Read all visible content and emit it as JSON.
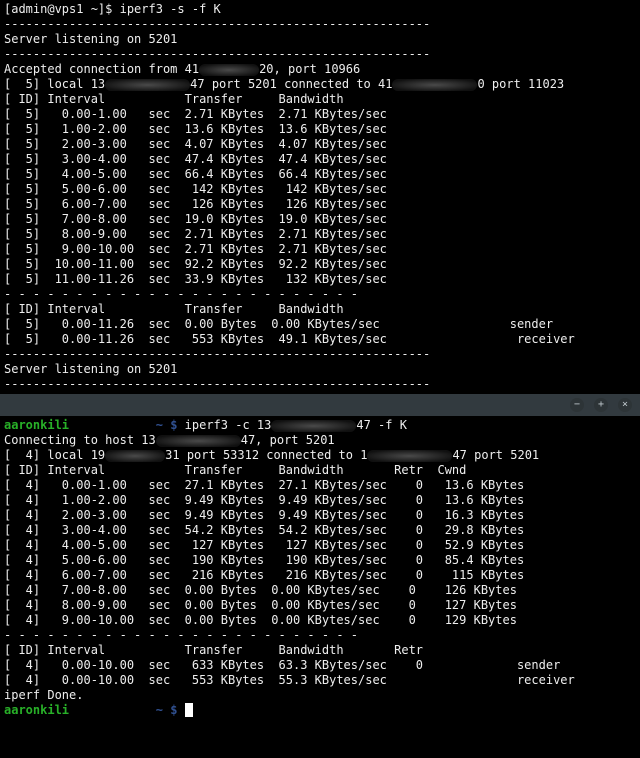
{
  "top": {
    "prompt": "[admin@vps1 ~]$ iperf3 -s -f K",
    "listening": "Server listening on 5201",
    "divider": "-----------------------------------------------------------",
    "accepted_pre": "Accepted connection from 41",
    "accepted_post": "20, port 10966",
    "local_pre": "[  5] local 13",
    "local_mid": "47 port 5201 connected to 41",
    "local_post": "0 port 11023",
    "header": "[ ID] Interval           Transfer     Bandwidth",
    "rows": [
      "[  5]   0.00-1.00   sec  2.71 KBytes  2.71 KBytes/sec                  ",
      "[  5]   1.00-2.00   sec  13.6 KBytes  13.6 KBytes/sec                  ",
      "[  5]   2.00-3.00   sec  4.07 KBytes  4.07 KBytes/sec                  ",
      "[  5]   3.00-4.00   sec  47.4 KBytes  47.4 KBytes/sec                  ",
      "[  5]   4.00-5.00   sec  66.4 KBytes  66.4 KBytes/sec                  ",
      "[  5]   5.00-6.00   sec   142 KBytes   142 KBytes/sec                  ",
      "[  5]   6.00-7.00   sec   126 KBytes   126 KBytes/sec                  ",
      "[  5]   7.00-8.00   sec  19.0 KBytes  19.0 KBytes/sec                  ",
      "[  5]   8.00-9.00   sec  2.71 KBytes  2.71 KBytes/sec                  ",
      "[  5]   9.00-10.00  sec  2.71 KBytes  2.71 KBytes/sec                  ",
      "[  5]  10.00-11.00  sec  92.2 KBytes  92.2 KBytes/sec                  ",
      "[  5]  11.00-11.26  sec  33.9 KBytes   132 KBytes/sec                  "
    ],
    "sep": "- - - - - - - - - - - - - - - - - - - - - - - - -",
    "summary": [
      "[  5]   0.00-11.26  sec  0.00 Bytes  0.00 KBytes/sec                  sender",
      "[  5]   0.00-11.26  sec   553 KBytes  49.1 KBytes/sec                  receiver"
    ]
  },
  "titlebar": {
    "min": "−",
    "max": "+",
    "close": "×"
  },
  "bottom": {
    "user": "aaronkili",
    "pathprompt": " ~ $ ",
    "cmd": "iperf3 -c 13",
    "cmd_post": "47 -f K",
    "connecting_pre": "Connecting to host 13",
    "connecting_post": "47, port 5201",
    "local_pre": "[  4] local 19",
    "local_mid": "31 port 53312 connected to 1",
    "local_post": "47 port 5201",
    "header": "[ ID] Interval           Transfer     Bandwidth       Retr  Cwnd",
    "rows": [
      "[  4]   0.00-1.00   sec  27.1 KBytes  27.1 KBytes/sec    0   13.6 KBytes       ",
      "[  4]   1.00-2.00   sec  9.49 KBytes  9.49 KBytes/sec    0   13.6 KBytes       ",
      "[  4]   2.00-3.00   sec  9.49 KBytes  9.49 KBytes/sec    0   16.3 KBytes       ",
      "[  4]   3.00-4.00   sec  54.2 KBytes  54.2 KBytes/sec    0   29.8 KBytes       ",
      "[  4]   4.00-5.00   sec   127 KBytes   127 KBytes/sec    0   52.9 KBytes       ",
      "[  4]   5.00-6.00   sec   190 KBytes   190 KBytes/sec    0   85.4 KBytes       ",
      "[  4]   6.00-7.00   sec   216 KBytes   216 KBytes/sec    0    115 KBytes       ",
      "[  4]   7.00-8.00   sec  0.00 Bytes  0.00 KBytes/sec    0    126 KBytes       ",
      "[  4]   8.00-9.00   sec  0.00 Bytes  0.00 KBytes/sec    0    127 KBytes       ",
      "[  4]   9.00-10.00  sec  0.00 Bytes  0.00 KBytes/sec    0    129 KBytes       "
    ],
    "sep": "- - - - - - - - - - - - - - - - - - - - - - - - -",
    "header2": "[ ID] Interval           Transfer     Bandwidth       Retr",
    "summary": [
      "[  4]   0.00-10.00  sec   633 KBytes  63.3 KBytes/sec    0             sender",
      "[  4]   0.00-10.00  sec   553 KBytes  55.3 KBytes/sec                  receiver"
    ],
    "done": "iperf Done."
  }
}
